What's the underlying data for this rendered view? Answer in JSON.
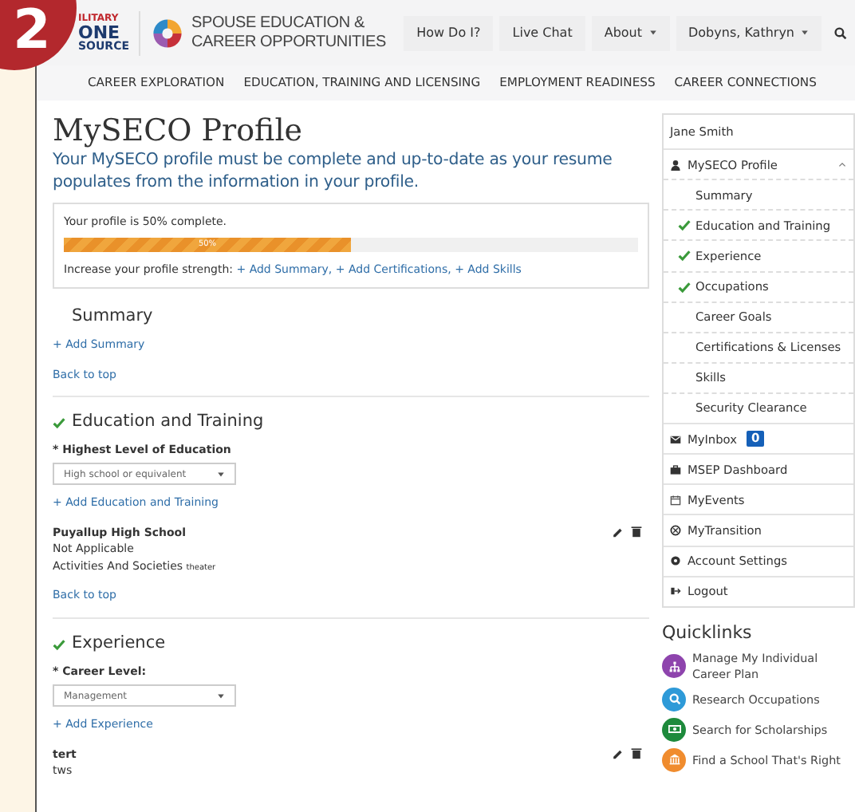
{
  "step_badge": "2",
  "header": {
    "logo_left": [
      "ILITARY",
      "ONE",
      "SOURCE"
    ],
    "logo_title": [
      "SPOUSE EDUCATION &",
      "CAREER OPPORTUNITIES"
    ],
    "top_links": [
      {
        "label": "How Do I?",
        "dropdown": false
      },
      {
        "label": "Live Chat",
        "dropdown": false
      },
      {
        "label": "About",
        "dropdown": true
      },
      {
        "label": "Dobyns, Kathryn",
        "dropdown": true
      }
    ]
  },
  "main_nav": [
    "CAREER EXPLORATION",
    "EDUCATION, TRAINING AND LICENSING",
    "EMPLOYMENT READINESS",
    "CAREER CONNECTIONS"
  ],
  "page": {
    "title": "MySECO Profile",
    "intro": "Your MySECO profile must be complete and up-to-date as your resume populates from the information in your profile.",
    "progress": {
      "caption": "Your profile is 50% complete.",
      "level": 0.5,
      "label": "50%",
      "hint": "Increase your profile strength:",
      "links": [
        "+ Add Summary,",
        "+ Add Certifications,",
        "+ Add Skills"
      ]
    },
    "sections": [
      {
        "title": "Summary",
        "complete": false,
        "add_link": "+ Add Summary",
        "back": "Back to top"
      },
      {
        "title": "Education and Training",
        "complete": true,
        "field_label": "* Highest Level of Education",
        "field_value": "High school or equivalent",
        "add_link": "+ Add Education and Training",
        "entry": {
          "title": "Puyallup High School",
          "lines": [
            "Not Applicable",
            "Activities And Societies **theater**"
          ]
        },
        "back": "Back to top"
      },
      {
        "title": "Experience",
        "complete": true,
        "field_label": "* Career Level:",
        "field_value": "Management",
        "add_link": "+ Add Experience",
        "entry": {
          "title": "tert",
          "lines": [
            "tws"
          ]
        }
      }
    ]
  },
  "sidebar": {
    "user": "Jane Smith",
    "items": [
      {
        "kind": "group",
        "label": "MySECO Profile",
        "expanded": true,
        "children": [
          {
            "label": "Summary",
            "checked": false
          },
          {
            "label": "Education and Training",
            "checked": true
          },
          {
            "label": "Experience",
            "checked": true
          },
          {
            "label": "Occupations",
            "checked": true
          },
          {
            "label": "Career Goals",
            "checked": false
          },
          {
            "label": "Certifications & Licenses",
            "checked": false
          },
          {
            "label": "Skills",
            "checked": false
          },
          {
            "label": "Security Clearance",
            "checked": false
          }
        ]
      },
      {
        "kind": "link",
        "label": "MyInbox",
        "badge": "0"
      },
      {
        "kind": "link",
        "label": "MSEP Dashboard"
      },
      {
        "kind": "link",
        "label": "MyEvents"
      },
      {
        "kind": "link",
        "label": "MyTransition"
      },
      {
        "kind": "link",
        "label": "Account Settings"
      },
      {
        "kind": "link",
        "label": "Logout"
      }
    ]
  },
  "quicklinks": {
    "title": "Quicklinks",
    "items": [
      {
        "label": "Manage My Individual Career Plan",
        "color": "#8e44ad"
      },
      {
        "label": "Research Occupations",
        "color": "#2e9ad8"
      },
      {
        "label": "Search for Scholarships",
        "color": "#1e8a3c"
      },
      {
        "label": "Find a School That's Right",
        "color": "#f08c2e"
      }
    ]
  }
}
